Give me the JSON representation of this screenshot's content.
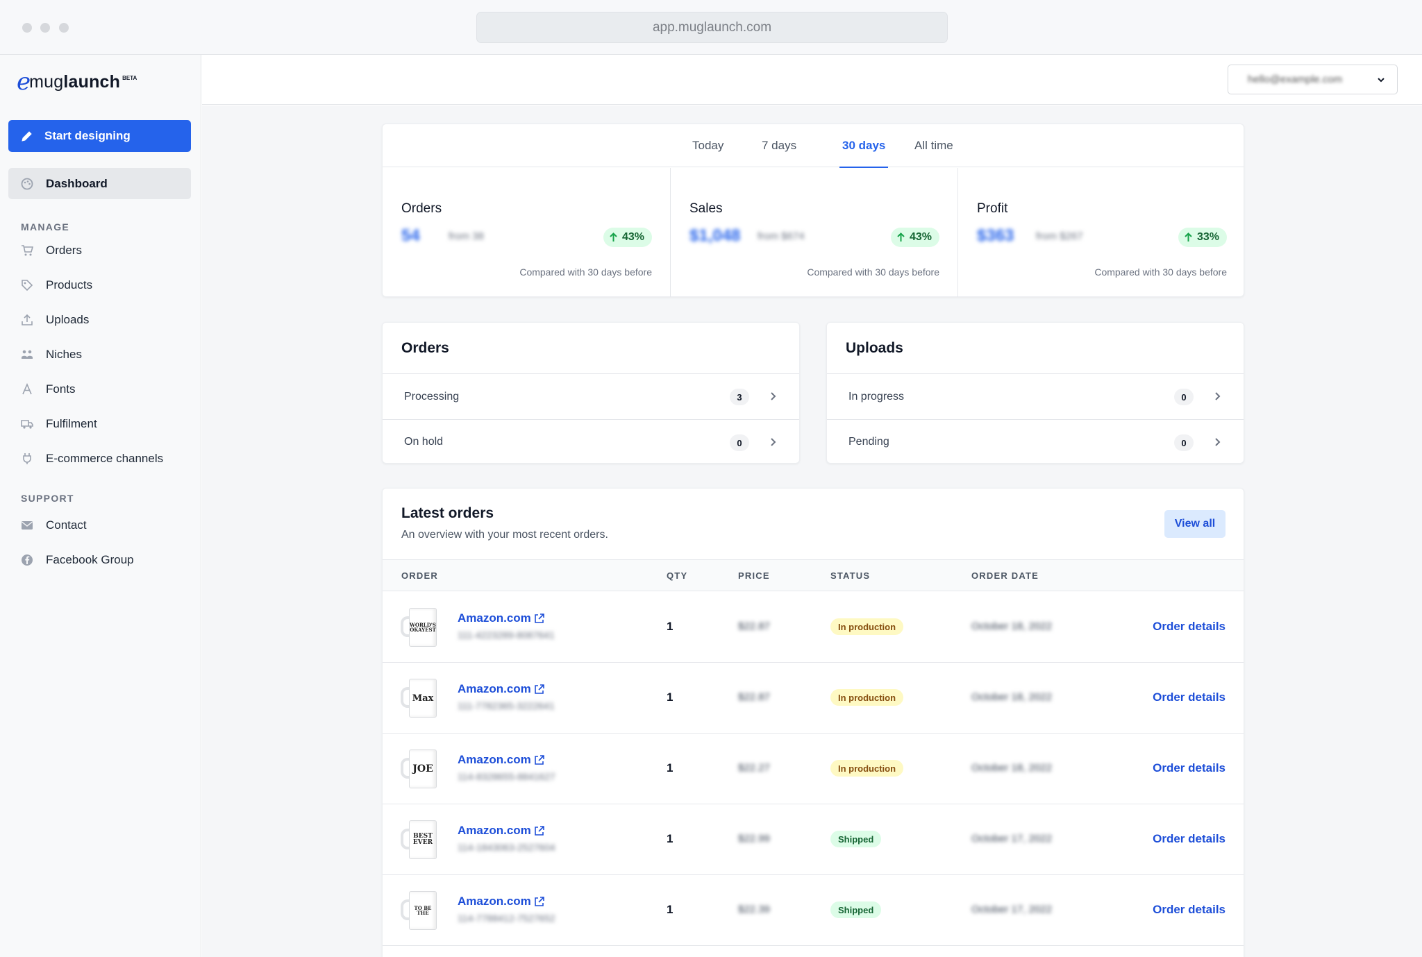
{
  "browser": {
    "url": "app.muglaunch.com"
  },
  "brand": {
    "logo_mark": "e",
    "name_prefix": "mug",
    "name_suffix": "launch",
    "badge": "BETA",
    "accent_color": "#2563eb"
  },
  "sidebar": {
    "cta_label": "Start designing",
    "active_item": "Dashboard",
    "manage_heading": "MANAGE",
    "manage_items": [
      {
        "label": "Orders",
        "icon": "cart-icon"
      },
      {
        "label": "Products",
        "icon": "tag-icon"
      },
      {
        "label": "Uploads",
        "icon": "upload-icon"
      },
      {
        "label": "Niches",
        "icon": "users-icon"
      },
      {
        "label": "Fonts",
        "icon": "font-icon"
      },
      {
        "label": "Fulfilment",
        "icon": "truck-icon"
      },
      {
        "label": "E-commerce channels",
        "icon": "plug-icon"
      }
    ],
    "support_heading": "SUPPORT",
    "support_items": [
      {
        "label": "Contact",
        "icon": "mail-icon"
      },
      {
        "label": "Facebook Group",
        "icon": "facebook-icon"
      }
    ]
  },
  "header": {
    "account_email": "hello@example.com"
  },
  "stats": {
    "tabs": [
      "Today",
      "7 days",
      "30 days",
      "All time"
    ],
    "active_tab": "30 days",
    "cards": [
      {
        "label": "Orders",
        "value": "54",
        "previous": "from 38",
        "change": "43%",
        "compare": "Compared with 30 days before"
      },
      {
        "label": "Sales",
        "value": "$1,048",
        "previous": "from $674",
        "change": "43%",
        "compare": "Compared with 30 days before"
      },
      {
        "label": "Profit",
        "value": "$363",
        "previous": "from $267",
        "change": "33%",
        "compare": "Compared with 30 days before"
      }
    ]
  },
  "orders_card": {
    "title": "Orders",
    "rows": [
      {
        "label": "Processing",
        "count": "3"
      },
      {
        "label": "On hold",
        "count": "0"
      }
    ]
  },
  "uploads_card": {
    "title": "Uploads",
    "rows": [
      {
        "label": "In progress",
        "count": "0"
      },
      {
        "label": "Pending",
        "count": "0"
      }
    ]
  },
  "latest_orders": {
    "title": "Latest orders",
    "subtitle": "An overview with your most recent orders.",
    "view_all_label": "View all",
    "columns": [
      "ORDER",
      "QTY",
      "PRICE",
      "STATUS",
      "ORDER DATE"
    ],
    "rows": [
      {
        "mug_text": "WORLD'S OKAYEST",
        "store": "Amazon.com",
        "order_id": "111-4223289-8087641",
        "qty": "1",
        "price": "$22.87",
        "status": "In production",
        "date": "October 18, 2022",
        "action": "Order details"
      },
      {
        "mug_text": "Max",
        "store": "Amazon.com",
        "order_id": "111-7782365-3222641",
        "qty": "1",
        "price": "$22.87",
        "status": "In production",
        "date": "October 18, 2022",
        "action": "Order details"
      },
      {
        "mug_text": "JOE",
        "store": "Amazon.com",
        "order_id": "114-8328655-8841627",
        "qty": "1",
        "price": "$22.27",
        "status": "In production",
        "date": "October 18, 2022",
        "action": "Order details"
      },
      {
        "mug_text": "BEST EVER",
        "store": "Amazon.com",
        "order_id": "114-1843063-2527604",
        "qty": "1",
        "price": "$22.99",
        "status": "Shipped",
        "date": "October 17, 2022",
        "action": "Order details"
      },
      {
        "mug_text": "TO BE THE",
        "store": "Amazon.com",
        "order_id": "114-7788412-7527652",
        "qty": "1",
        "price": "$22.39",
        "status": "Shipped",
        "date": "October 17, 2022",
        "action": "Order details"
      }
    ],
    "status_colors": {
      "In production": {
        "bg": "#fef9c3",
        "fg": "#854d0e"
      },
      "Shipped": {
        "bg": "#dcfce7",
        "fg": "#166534"
      }
    }
  }
}
